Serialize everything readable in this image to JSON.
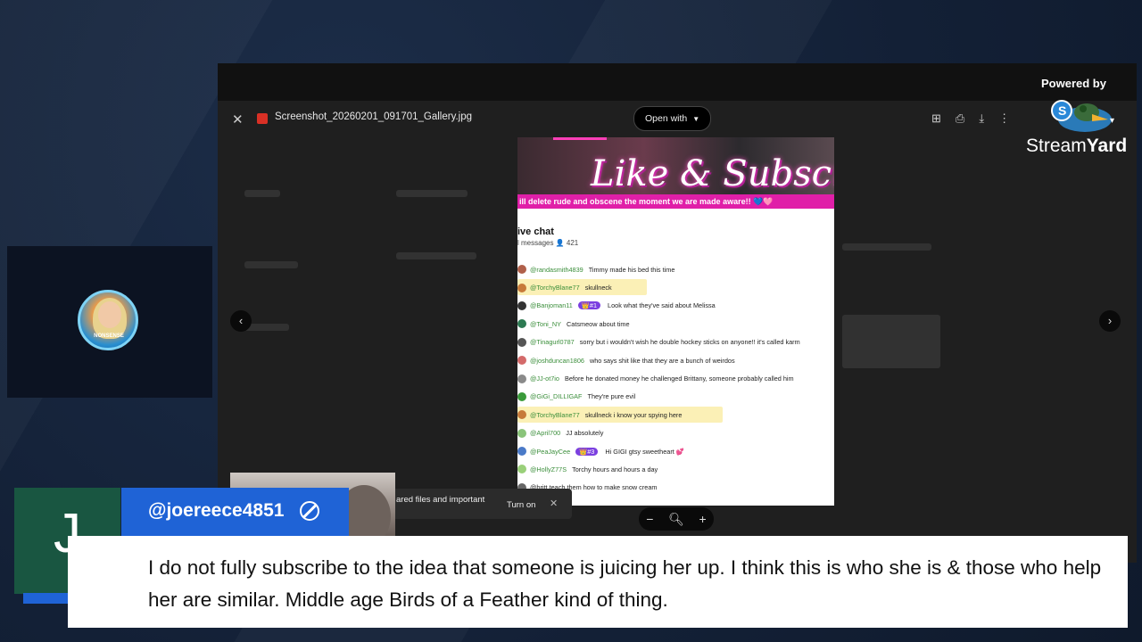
{
  "viewer": {
    "file_name": "Screenshot_20260201_091701_Gallery.jpg",
    "open_with": "Open with",
    "close_icon": "close-icon",
    "toolbar_icons": [
      "add-comment-icon",
      "print-icon",
      "download-icon",
      "more-vert-icon"
    ]
  },
  "screenshot": {
    "banner_title": "Like & Subscri",
    "banner_ticker": "ill delete rude and obscene the moment we are made aware!! 💙🩷",
    "chat_title": "ive chat",
    "chat_sub": "l messages  👤 421",
    "messages": [
      {
        "user": "@randasmith4839",
        "text": "Timmy made his bed this time",
        "hl": false,
        "color": "#b0604a"
      },
      {
        "user": "@TorchyBlane77",
        "text": "skullneck",
        "hl": true,
        "color": "#c77a3a"
      },
      {
        "user": "@Banjoman11",
        "badge": "👑#1",
        "text": "Look what they've said about Melissa",
        "hl": false,
        "color": "#333"
      },
      {
        "user": "@Toni_NY",
        "text": "Catsmeow about time",
        "hl": false,
        "color": "#2d7a52"
      },
      {
        "user": "@Tinagurl0787",
        "text": "sorry but i wouldn't wish he double hockey sticks on anyone!! it's called karm",
        "hl": false,
        "color": "#555"
      },
      {
        "user": "@joshduncan1806",
        "text": "who says shit like that they are a bunch of weirdos",
        "hl": false,
        "color": "#d46a6a"
      },
      {
        "user": "@JJ-ot7io",
        "text": "Before he donated money he challenged Brittany, someone probably called him",
        "hl": false,
        "color": "#8a8a8a"
      },
      {
        "user": "@GiGi_DILLIGAF",
        "text": "They're pure evil",
        "hl": false,
        "color": "#3a9a3a"
      },
      {
        "user": "@TorchyBlane77",
        "text": "skullneck i know your spying here",
        "hl": true,
        "color": "#c77a3a"
      },
      {
        "user": "@April700",
        "text": "JJ absolutely",
        "hl": false,
        "color": "#8ac47a"
      },
      {
        "user": "@PeaJayCee",
        "badge": "👑#3",
        "text": "Hi GIGI gtsy sweetheart 💕",
        "hl": false,
        "color": "#4a7ac8"
      },
      {
        "user": "@HollyZ77S",
        "text": "Torchy hours and hours a day",
        "hl": false,
        "color": "#9ad07a"
      },
      {
        "user": "",
        "text": "@britt teach them how to make snow cream",
        "hl": false,
        "color": "#666"
      }
    ]
  },
  "notification": {
    "text": "ared files and important",
    "button": "Turn on"
  },
  "branding": {
    "powered_by": "Powered by",
    "stream": "Stream",
    "yard": "Yard"
  },
  "guest": {
    "avatar_label": "NONSENSE"
  },
  "comment": {
    "avatar_letter": "J",
    "username": "@joereece4851",
    "text": "I do not fully subscribe to the idea that someone is juicing her up. I think this is who she is & those who help her are similar. Middle age Birds of a Feather kind of thing."
  }
}
